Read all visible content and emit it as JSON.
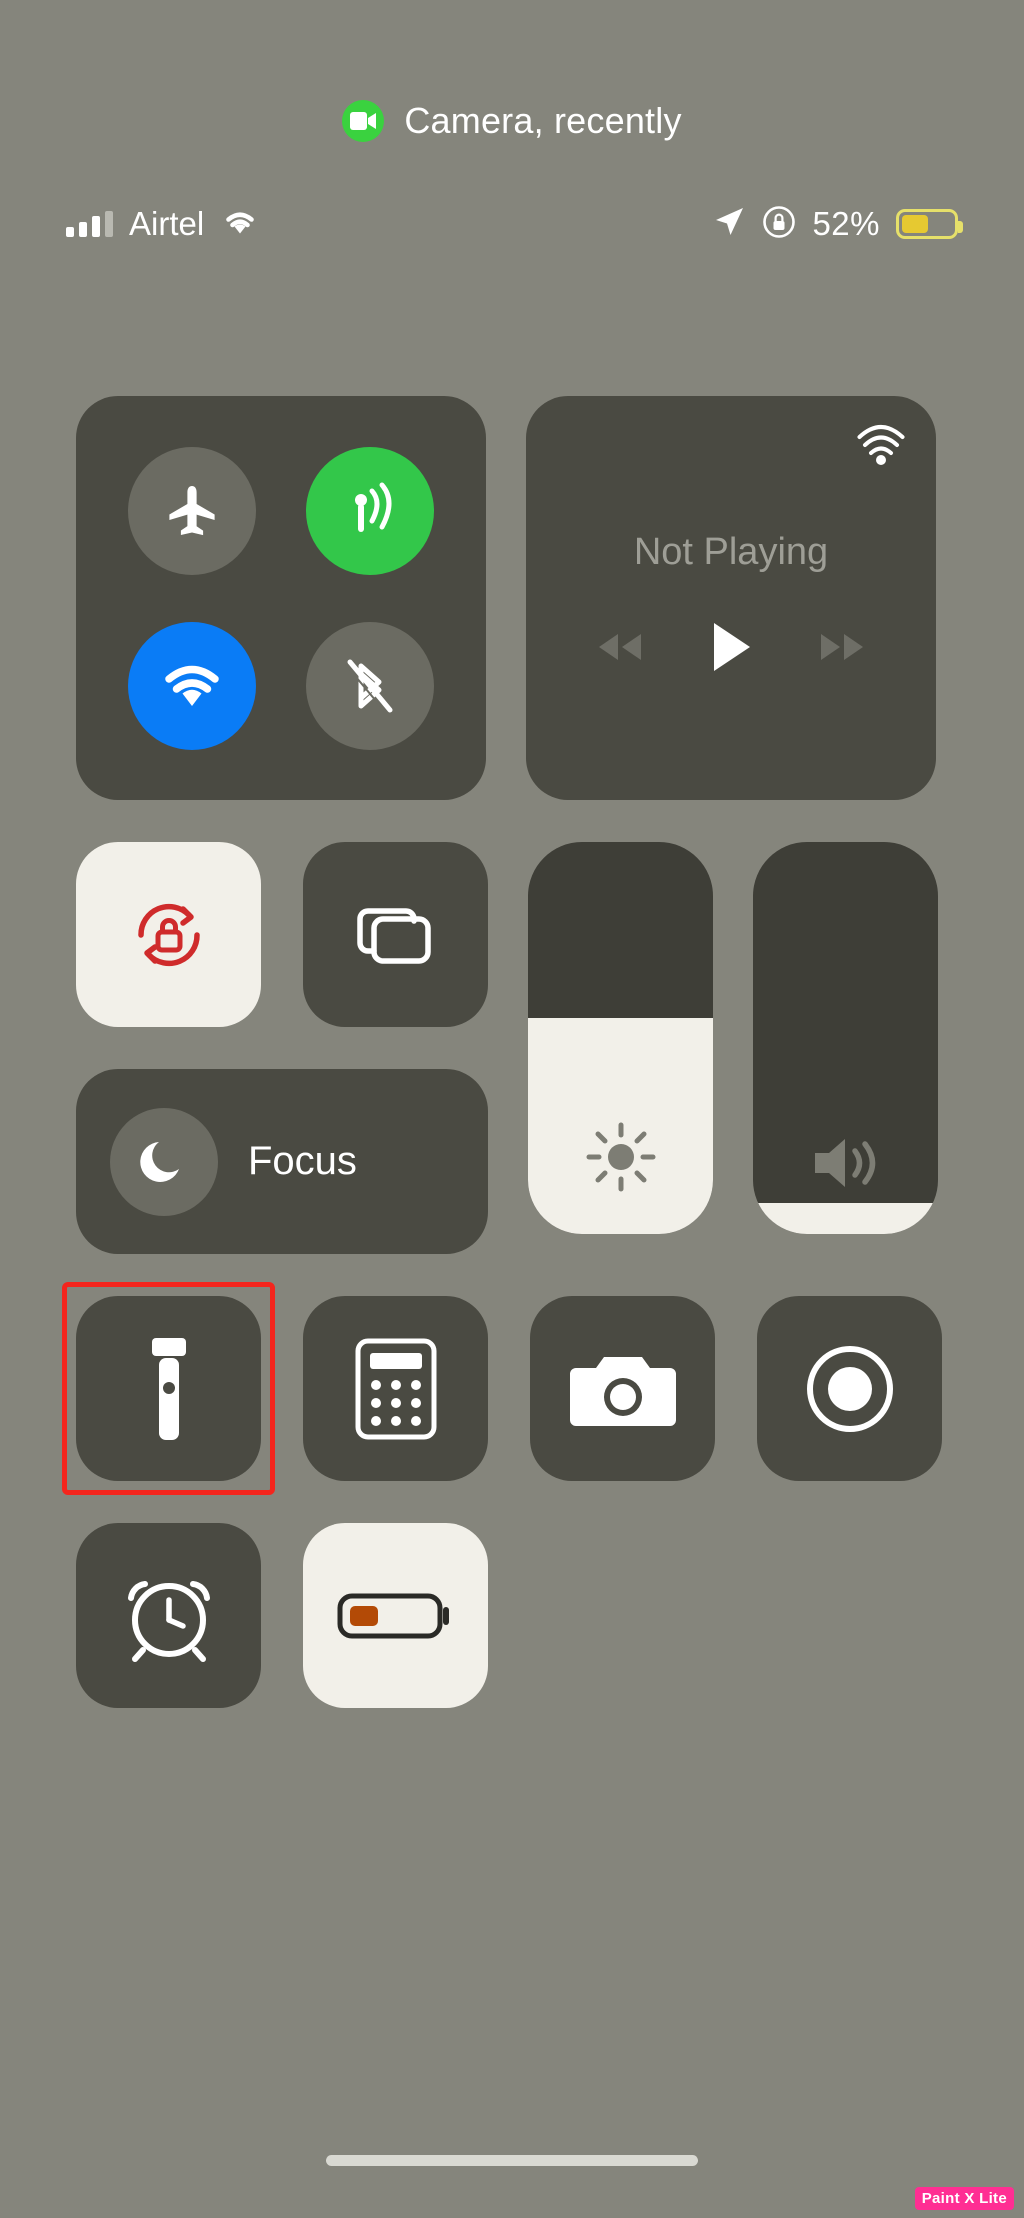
{
  "privacy": {
    "icon": "camera-video-icon",
    "text": "Camera, recently",
    "dot_color": "#3ad23f"
  },
  "status_bar": {
    "carrier": "Airtel",
    "signal_bars_filled": 3,
    "signal_bars_total": 4,
    "wifi_icon": "wifi-icon",
    "location_icon": "location-arrow-icon",
    "rotation_lock_icon": "rotation-lock-icon",
    "battery_percent": "52%",
    "battery_level": 52,
    "battery_color": "#e6c931",
    "low_power_mode": true
  },
  "connectivity": {
    "airplane_mode": {
      "name": "airplane-mode",
      "state": "off",
      "color": "#6b6b62"
    },
    "cellular_data": {
      "name": "cellular-data",
      "state": "on",
      "color": "#33c74a"
    },
    "wifi": {
      "name": "wifi",
      "state": "on",
      "color": "#0a7cf6"
    },
    "bluetooth": {
      "name": "bluetooth",
      "state": "off",
      "color": "#6b6b62"
    }
  },
  "media": {
    "airplay_icon": "airplay-audio-icon",
    "status": "Not Playing",
    "rewind_label": "rewind-icon",
    "play_label": "play-icon",
    "forward_label": "fast-forward-icon"
  },
  "controls": {
    "rotation_lock": {
      "label": "rotation-lock",
      "state": "on",
      "accent": "#cf2b2b"
    },
    "screen_mirroring": {
      "label": "screen-mirroring",
      "state": "off"
    },
    "focus": {
      "label": "Focus",
      "state": "off"
    },
    "brightness": {
      "label": "brightness",
      "value": 55
    },
    "volume": {
      "label": "volume",
      "value": 8
    }
  },
  "toggles": [
    {
      "name": "flashlight",
      "icon": "flashlight-icon",
      "state": "off",
      "highlighted": true
    },
    {
      "name": "calculator",
      "icon": "calculator-icon",
      "state": "off",
      "highlighted": false
    },
    {
      "name": "camera",
      "icon": "camera-icon",
      "state": "off",
      "highlighted": false
    },
    {
      "name": "screen-record",
      "icon": "screen-record-icon",
      "state": "off",
      "highlighted": false
    },
    {
      "name": "alarm",
      "icon": "alarm-clock-icon",
      "state": "off",
      "highlighted": false
    },
    {
      "name": "low-power-mode",
      "icon": "battery-low-power-icon",
      "state": "on",
      "highlighted": false
    }
  ],
  "home_indicator": "home-indicator",
  "watermark": "Paint X Lite",
  "theme": {
    "background": "#85857c",
    "module_bg": "#4a4a42",
    "active_light": "#f2f0e9",
    "highlight": "#f4251d"
  }
}
